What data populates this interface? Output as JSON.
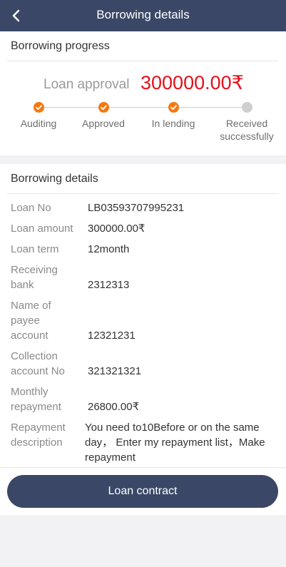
{
  "header": {
    "title": "Borrowing details",
    "back_icon": "chevron-left-icon"
  },
  "progress": {
    "title": "Borrowing progress",
    "approval_label": "Loan approval",
    "approval_amount": "300000.00₹",
    "steps": [
      {
        "label": "Auditing",
        "status": "done"
      },
      {
        "label": "Approved",
        "status": "done"
      },
      {
        "label": "In lending",
        "status": "done"
      },
      {
        "label": "Received successfully",
        "status": "pending"
      }
    ],
    "colors": {
      "done": "#f5780f",
      "pending": "#cfcfcf",
      "amount": "#e4101a"
    }
  },
  "details": {
    "title": "Borrowing details",
    "rows": [
      {
        "label": "Loan No",
        "value": "LB03593707995231"
      },
      {
        "label": "Loan amount",
        "value": "300000.00₹"
      },
      {
        "label": "Loan term",
        "value": "12month"
      },
      {
        "label": "Receiving bank",
        "value": "2312313"
      },
      {
        "label": "Name of payee account",
        "value": "12321231"
      },
      {
        "label": "Collection account No",
        "value": "321321321"
      },
      {
        "label": "Monthly repayment",
        "value": "26800.00₹"
      },
      {
        "label": "Repayment description",
        "value": "You need to10Before or on the same day， Enter my repayment list，Make repayment"
      }
    ]
  },
  "actions": {
    "contract_label": "Loan contract"
  },
  "theme": {
    "primary": "#3a4766"
  }
}
